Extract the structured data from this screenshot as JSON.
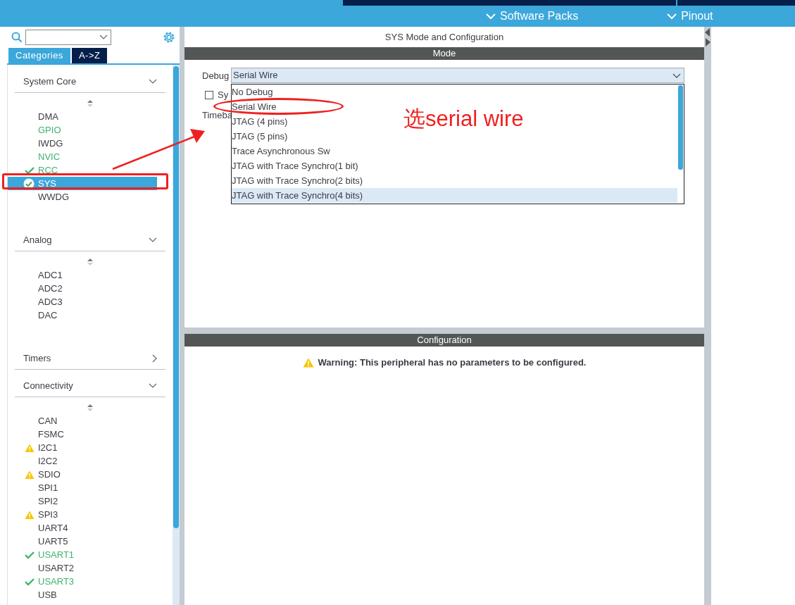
{
  "top_bar": {
    "menus": [
      {
        "label": "Software Packs"
      },
      {
        "label": "Pinout"
      }
    ]
  },
  "sidebar": {
    "tabs": [
      {
        "label": "Categories",
        "selected": true
      },
      {
        "label": "A->Z",
        "selected": false
      }
    ],
    "categories": [
      {
        "name": "System Core",
        "expanded": true,
        "items": [
          {
            "label": "DMA",
            "enabled": false,
            "ok": false,
            "warning": false,
            "selected": false
          },
          {
            "label": "GPIO",
            "enabled": true,
            "ok": false,
            "warning": false,
            "selected": false
          },
          {
            "label": "IWDG",
            "enabled": false,
            "ok": false,
            "warning": false,
            "selected": false
          },
          {
            "label": "NVIC",
            "enabled": true,
            "ok": false,
            "warning": false,
            "selected": false
          },
          {
            "label": "RCC",
            "enabled": true,
            "ok": true,
            "warning": false,
            "selected": false
          },
          {
            "label": "SYS",
            "enabled": true,
            "ok": true,
            "warning": false,
            "selected": true
          },
          {
            "label": "WWDG",
            "enabled": false,
            "ok": false,
            "warning": false,
            "selected": false
          }
        ]
      },
      {
        "name": "Analog",
        "expanded": true,
        "items": [
          {
            "label": "ADC1",
            "enabled": false,
            "ok": false,
            "warning": false,
            "selected": false
          },
          {
            "label": "ADC2",
            "enabled": false,
            "ok": false,
            "warning": false,
            "selected": false
          },
          {
            "label": "ADC3",
            "enabled": false,
            "ok": false,
            "warning": false,
            "selected": false
          },
          {
            "label": "DAC",
            "enabled": false,
            "ok": false,
            "warning": false,
            "selected": false
          }
        ]
      },
      {
        "name": "Timers",
        "expanded": false
      },
      {
        "name": "Connectivity",
        "expanded": true,
        "items": [
          {
            "label": "CAN",
            "enabled": false,
            "ok": false,
            "warning": false,
            "selected": false
          },
          {
            "label": "FSMC",
            "enabled": false,
            "ok": false,
            "warning": false,
            "selected": false
          },
          {
            "label": "I2C1",
            "enabled": false,
            "ok": false,
            "warning": true,
            "selected": false
          },
          {
            "label": "I2C2",
            "enabled": false,
            "ok": false,
            "warning": false,
            "selected": false
          },
          {
            "label": "SDIO",
            "enabled": false,
            "ok": false,
            "warning": true,
            "selected": false
          },
          {
            "label": "SPI1",
            "enabled": false,
            "ok": false,
            "warning": false,
            "selected": false
          },
          {
            "label": "SPI2",
            "enabled": false,
            "ok": false,
            "warning": false,
            "selected": false
          },
          {
            "label": "SPI3",
            "enabled": false,
            "ok": false,
            "warning": true,
            "selected": false
          },
          {
            "label": "UART4",
            "enabled": false,
            "ok": false,
            "warning": false,
            "selected": false
          },
          {
            "label": "UART5",
            "enabled": false,
            "ok": false,
            "warning": false,
            "selected": false
          },
          {
            "label": "USART1",
            "enabled": true,
            "ok": true,
            "warning": false,
            "selected": false
          },
          {
            "label": "USART2",
            "enabled": false,
            "ok": false,
            "warning": false,
            "selected": false
          },
          {
            "label": "USART3",
            "enabled": true,
            "ok": true,
            "warning": false,
            "selected": false
          },
          {
            "label": "USB",
            "enabled": false,
            "ok": false,
            "warning": false,
            "selected": false
          }
        ]
      }
    ]
  },
  "mode_panel": {
    "title": "SYS Mode and Configuration",
    "header": "Mode",
    "debug": {
      "label": "Debug",
      "value": "Serial Wire",
      "options": [
        {
          "label": "No Debug",
          "highlighted": false
        },
        {
          "label": "Serial Wire",
          "highlighted": false
        },
        {
          "label": "JTAG (4 pins)",
          "highlighted": false
        },
        {
          "label": "JTAG (5 pins)",
          "highlighted": false
        },
        {
          "label": "Trace Asynchronous Sw",
          "highlighted": false
        },
        {
          "label": "JTAG with Trace Synchro(1 bit)",
          "highlighted": false
        },
        {
          "label": "JTAG with Trace Synchro(2 bits)",
          "highlighted": false
        },
        {
          "label": "JTAG with Trace Synchro(4 bits)",
          "highlighted": true
        }
      ]
    },
    "sys_checkbox": {
      "label": "Sy",
      "checked": false
    },
    "timebase_label": "Timeba"
  },
  "configuration_panel": {
    "header": "Configuration",
    "warning": "Warning: This peripheral has no parameters to be configured."
  },
  "annotation": {
    "text": "选serial wire"
  }
}
